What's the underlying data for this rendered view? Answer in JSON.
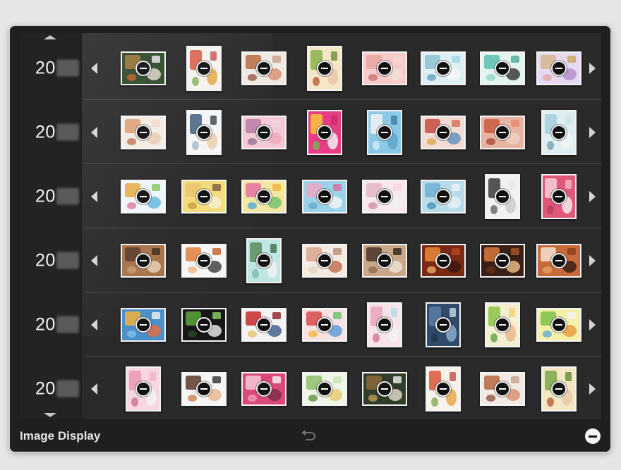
{
  "panel": {
    "footer_label": "Image Display",
    "icons": {
      "scroll_up": "triangle-up-icon",
      "scroll_down": "triangle-down-icon",
      "row_left": "chevron-left-icon",
      "row_right": "chevron-right-icon",
      "undo": "undo-arrow-icon",
      "remove": "minus-circle-icon",
      "thumb_badge": "minus-icon"
    }
  },
  "rows": [
    {
      "year": "20",
      "thumbs": [
        {
          "bg": "#2f4a2c",
          "a": "#a57a3e",
          "b": "#e8e0d4",
          "c": "#c9632b",
          "d": "#f1f1f1"
        },
        {
          "bg": "#f6f3ee",
          "a": "#d4553a",
          "b": "#e3a33f",
          "c": "#7aa74f",
          "d": "#c44d4d"
        },
        {
          "bg": "#efe9e2",
          "a": "#b5673e",
          "b": "#d88d6a",
          "c": "#8c4a3a",
          "d": "#c9a08b"
        },
        {
          "bg": "#f6e6c8",
          "a": "#8bb14a",
          "b": "#e9c7a5",
          "c": "#b3572e",
          "d": "#6c8d34"
        },
        {
          "bg": "#f7cbc9",
          "a": "#e8a4a0",
          "b": "#f3e0d9",
          "c": "#c86c68",
          "d": "#f7d6d2"
        },
        {
          "bg": "#dff0f4",
          "a": "#8ec1d2",
          "b": "#f6f6f6",
          "c": "#5f9fbf",
          "d": "#a7d3e0"
        },
        {
          "bg": "#e4f4f0",
          "a": "#59c1b2",
          "b": "#2f2f2f",
          "c": "#8fd6c6",
          "d": "#4aa99a"
        },
        {
          "bg": "#e8d9f2",
          "a": "#d4b58e",
          "b": "#b38ac9",
          "c": "#e4a2a2",
          "d": "#c9a45c"
        }
      ]
    },
    {
      "year": "20",
      "thumbs": [
        {
          "bg": "#f3ece4",
          "a": "#d89b6c",
          "b": "#e9c9ad",
          "c": "#b86a4a",
          "d": "#f1d7c4"
        },
        {
          "bg": "#f6f6f6",
          "a": "#3d5a7a",
          "b": "#e8c9a6",
          "c": "#9fb4c7",
          "d": "#2f3d4e"
        },
        {
          "bg": "#f3c9d6",
          "a": "#b57aa5",
          "b": "#e8a9b9",
          "c": "#8d6a8f",
          "d": "#f0d6e0"
        },
        {
          "bg": "#e83d86",
          "a": "#f9c83a",
          "b": "#f7f7f7",
          "c": "#6fbf4e",
          "d": "#c72a6c"
        },
        {
          "bg": "#8cc9e6",
          "a": "#f1f1f1",
          "b": "#5ba3c9",
          "c": "#d9eef7",
          "d": "#3f7ea3"
        },
        {
          "bg": "#f3dcd4",
          "a": "#c64b3d",
          "b": "#5c8fba",
          "c": "#e3a04a",
          "d": "#d66d5a"
        },
        {
          "bg": "#e8b4a3",
          "a": "#c95a3f",
          "b": "#f0d1c4",
          "c": "#a6402d",
          "d": "#e38b6d"
        },
        {
          "bg": "#dfeef2",
          "a": "#a6cfd9",
          "b": "#f4f4f4",
          "c": "#6d9fae",
          "d": "#c7e3ea"
        }
      ]
    },
    {
      "year": "20",
      "thumbs": [
        {
          "bg": "#f0f6fb",
          "a": "#e4a83a",
          "b": "#5ab5e0",
          "c": "#e06b9a",
          "d": "#7fc65a"
        },
        {
          "bg": "#f3dc7a",
          "a": "#e8c46d",
          "b": "#f7f0d2",
          "c": "#c9983a",
          "d": "#7a5a3a"
        },
        {
          "bg": "#f4e7a3",
          "a": "#e86da3",
          "b": "#6fbf6a",
          "c": "#4aa6d9",
          "d": "#f2b33a"
        },
        {
          "bg": "#9dd3e8",
          "a": "#e8a9c4",
          "b": "#f6f6f6",
          "c": "#5fa9c8",
          "d": "#d76f9d"
        },
        {
          "bg": "#f7e9ef",
          "a": "#e6b6c6",
          "b": "#f1f1f1",
          "c": "#cf8aa4",
          "d": "#f3d3df"
        },
        {
          "bg": "#b9dcea",
          "a": "#6fb2d4",
          "b": "#e6f2f7",
          "c": "#3f8db6",
          "d": "#f1f1f1"
        },
        {
          "bg": "#f1f1f1",
          "a": "#3a3a3a",
          "b": "#c9c9c9",
          "c": "#5a5a5a",
          "d": "#e8e8e8"
        },
        {
          "bg": "#e0577a",
          "a": "#f3d1d9",
          "b": "#f7f7f7",
          "c": "#b53c5c",
          "d": "#f6b7c6"
        }
      ]
    },
    {
      "year": "20",
      "thumbs": [
        {
          "bg": "#a8744a",
          "a": "#5a3a2a",
          "b": "#e9d4bc",
          "c": "#c8a27c",
          "d": "#3a2a1f"
        },
        {
          "bg": "#f6f6f6",
          "a": "#e27c3a",
          "b": "#3a3a3a",
          "c": "#f2b07a",
          "d": "#c85a28"
        },
        {
          "bg": "#bfe6e3",
          "a": "#5a8a5a",
          "b": "#f3f3f3",
          "c": "#7ab6b0",
          "d": "#3c6c4c"
        },
        {
          "bg": "#f3ebe2",
          "a": "#d9a68c",
          "b": "#c46a4c",
          "c": "#e8d1bf",
          "d": "#b38d70"
        },
        {
          "bg": "#c9a889",
          "a": "#4a3527",
          "b": "#f1e3d4",
          "c": "#8c6a4f",
          "d": "#2f2219"
        },
        {
          "bg": "#7a2a14",
          "a": "#e8893a",
          "b": "#3a160c",
          "c": "#f2b36a",
          "d": "#b3461f"
        },
        {
          "bg": "#3a1f14",
          "a": "#d97a3a",
          "b": "#f2c08a",
          "c": "#6a2f1a",
          "d": "#a8552a"
        },
        {
          "bg": "#c96a3a",
          "a": "#f4e2cf",
          "b": "#2f1c12",
          "c": "#e9a26a",
          "d": "#8a3f1c"
        }
      ]
    },
    {
      "year": "20",
      "thumbs": [
        {
          "bg": "#4a8fc9",
          "a": "#f2b33a",
          "b": "#e86a3a",
          "c": "#7fc6e8",
          "d": "#f3f3f3"
        },
        {
          "bg": "#161616",
          "a": "#5aa63a",
          "b": "#f1f1f1",
          "c": "#2a4a2a",
          "d": "#8ad16a"
        },
        {
          "bg": "#f3f3f3",
          "a": "#c92a2a",
          "b": "#3a5a8a",
          "c": "#e8c26a",
          "d": "#8a2020"
        },
        {
          "bg": "#f6e4e4",
          "a": "#d94a4a",
          "b": "#5a9ad9",
          "c": "#f2b33a",
          "d": "#6ac06a"
        },
        {
          "bg": "#f7e4ea",
          "a": "#e8a6b9",
          "b": "#f3f3f3",
          "c": "#c9708c",
          "d": "#b7d6ea"
        },
        {
          "bg": "#2f4a6a",
          "a": "#5a7ea6",
          "b": "#8fb1d2",
          "c": "#1f3450",
          "d": "#c9d9e8"
        },
        {
          "bg": "#f4efd2",
          "a": "#8cc24a",
          "b": "#e8b48c",
          "c": "#5a9a3a",
          "d": "#f2d36a"
        },
        {
          "bg": "#f4f0a8",
          "a": "#7ac04a",
          "b": "#e89a3a",
          "c": "#5aa6d9",
          "d": "#f3f3f3"
        }
      ]
    },
    {
      "year": "20",
      "thumbs": [
        {
          "bg": "#f6d6e0",
          "a": "#e89ab3",
          "b": "#f4f4f4",
          "c": "#c9688a",
          "d": "#f2b3c6"
        },
        {
          "bg": "#f6f6f6",
          "a": "#5a3a2a",
          "b": "#e8b48c",
          "c": "#c97a4a",
          "d": "#2f2f2f"
        },
        {
          "bg": "#d94a7a",
          "a": "#f3c9d6",
          "b": "#7a2a4a",
          "c": "#f2a3bf",
          "d": "#f7f7f7"
        },
        {
          "bg": "#eef6e8",
          "a": "#8cc06a",
          "b": "#e8c96a",
          "c": "#5a8a3a",
          "d": "#c9e3b6"
        },
        {
          "bg": "#2f3d2a",
          "a": "#8c6a3a",
          "b": "#e8e0d0",
          "c": "#c9a45a",
          "d": "#f1f1f1"
        },
        {
          "bg": "#f7f3ea",
          "a": "#d9553a",
          "b": "#e8a33f",
          "c": "#7aa74f",
          "d": "#c44d4d"
        },
        {
          "bg": "#f1ebe4",
          "a": "#b5673e",
          "b": "#d88d6a",
          "c": "#8c4a3a",
          "d": "#c9a08b"
        },
        {
          "bg": "#f3e7c4",
          "a": "#7aa64a",
          "b": "#e9c9a5",
          "c": "#b3572e",
          "d": "#5c8a34"
        }
      ]
    }
  ]
}
